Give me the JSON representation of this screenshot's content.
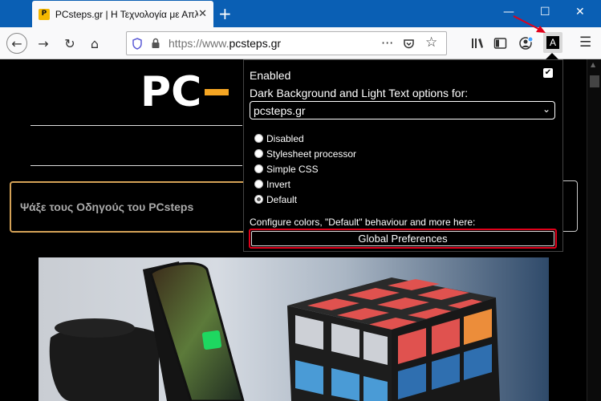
{
  "browser": {
    "tab_title": "PCsteps.gr | Η Τεχνολογία με Απλά Λόγια",
    "favicon_text": "P",
    "url_prefix": "https://www.",
    "url_domain": "pcsteps.gr",
    "tab_close_icon": "close-icon",
    "new_tab_icon": "plus-icon",
    "ext_letter": "A"
  },
  "page": {
    "logo_text": "PC",
    "search_text": "Ψάξε τους Οδηγούς του PCsteps",
    "accent_color": "#f5a623"
  },
  "popup": {
    "enabled_label": "Enabled",
    "enabled_checked": true,
    "options_label": "Dark Background and Light Text options for:",
    "site_select": "pcsteps.gr",
    "modes": [
      {
        "label": "Disabled",
        "checked": false
      },
      {
        "label": "Stylesheet processor",
        "checked": false
      },
      {
        "label": "Simple CSS",
        "checked": false
      },
      {
        "label": "Invert",
        "checked": false
      },
      {
        "label": "Default",
        "checked": true
      }
    ],
    "configure_label": "Configure colors, \"Default\" behaviour and more here:",
    "global_button": "Global Preferences",
    "highlight_color": "#e0001a"
  }
}
